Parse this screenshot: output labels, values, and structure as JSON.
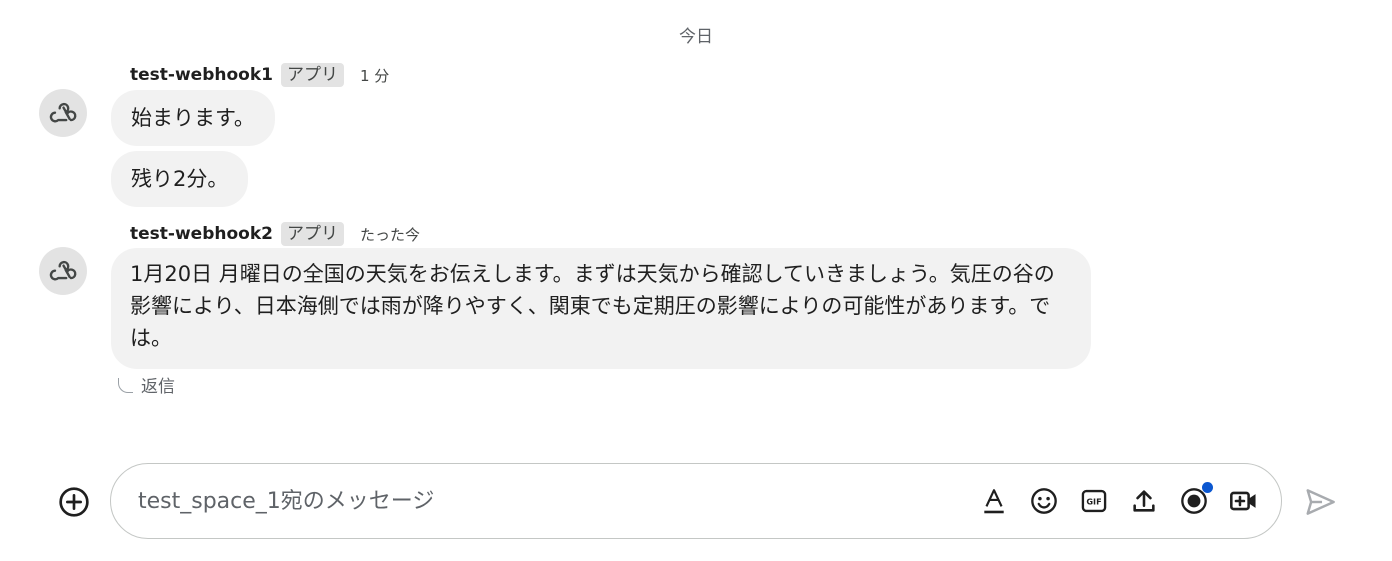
{
  "date_divider": "今日",
  "messages": [
    {
      "sender": "test-webhook1",
      "badge": "アプリ",
      "time": "1 分",
      "bubbles": [
        "始まります。",
        "残り2分。"
      ]
    },
    {
      "sender": "test-webhook2",
      "badge": "アプリ",
      "time": "たった今",
      "bubbles": [
        "1月20日 月曜日の全国の天気をお伝えします。まずは天気から確認していきましょう。気圧の谷の影響により、日本海側では雨が降りやすく、関東でも定期圧の影響によりの可能性があります。では。"
      ]
    }
  ],
  "reply_label": "返信",
  "composer": {
    "placeholder": "test_space_1宛のメッセージ",
    "tools": [
      "format-text-icon",
      "emoji-icon",
      "gif-icon",
      "upload-icon",
      "record-icon",
      "video-add-icon"
    ],
    "send_icon": "send-icon",
    "add_icon": "add-circle-icon"
  },
  "colors": {
    "bubble": "#f2f2f2",
    "notification_dot": "#0b57d0",
    "avatar_bg": "#e3e3e3"
  }
}
